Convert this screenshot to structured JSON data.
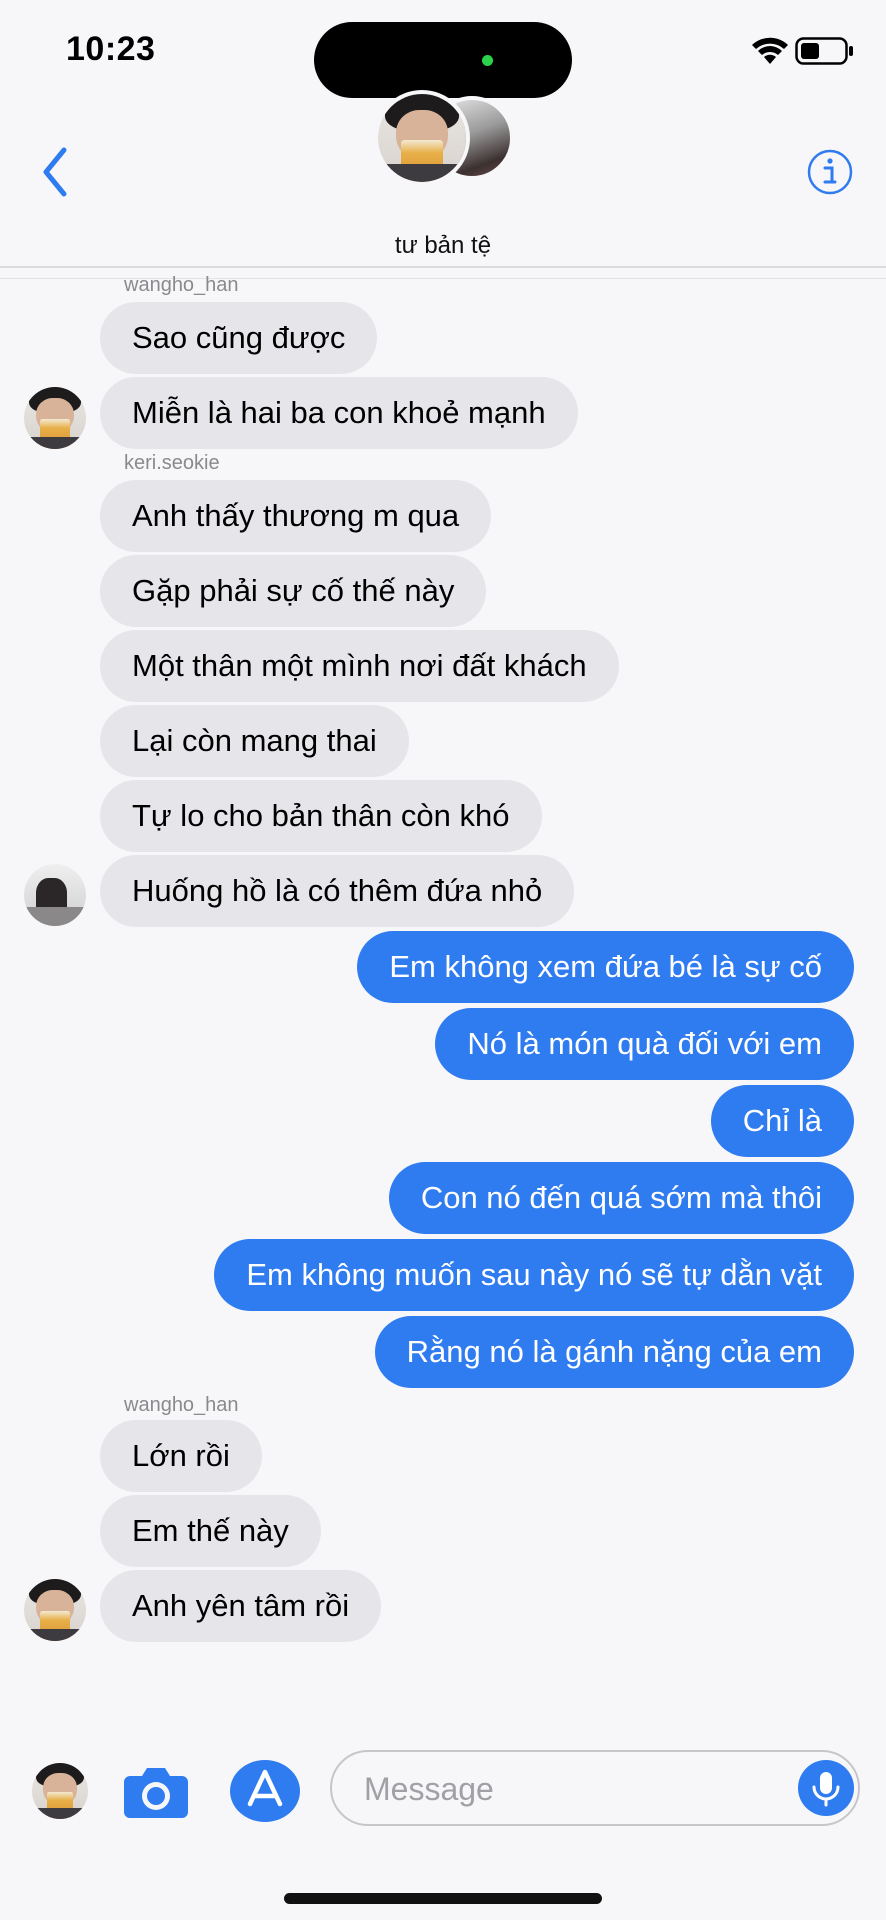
{
  "status_bar": {
    "time": "10:23"
  },
  "header": {
    "group_name": "tư bản tệ"
  },
  "colors": {
    "accent": "#2f7bf0",
    "incoming_bubble": "#e6e5ea",
    "background": "#f7f7f9"
  },
  "icons": {
    "back": "chevron-left-icon",
    "info": "info-circle-icon",
    "camera": "camera-icon",
    "apps": "app-store-icon",
    "mic": "microphone-icon"
  },
  "messages": {
    "sender_1": "wangho_han",
    "m1": "Sao cũng được",
    "m2": "Miễn là hai ba con khoẻ mạnh",
    "sender_2": "keri.seokie",
    "m3": "Anh thấy thương m qua",
    "m4": "Gặp phải sự cố thế này",
    "m5": "Một thân một mình nơi đất khách",
    "m6": "Lại còn mang thai",
    "m7": "Tự lo cho bản thân còn khó",
    "m8": "Huống hồ là có thêm đứa nhỏ",
    "o1": "Em không xem đứa bé là sự cố",
    "o2": "Nó là món quà đối với em",
    "o3": "Chỉ là",
    "o4": "Con nó đến quá sớm mà thôi",
    "o5": "Em không muốn sau này nó sẽ tự dằn vặt",
    "o6": "Rằng nó là gánh nặng của em",
    "sender_3": "wangho_han",
    "m9": "Lớn rồi",
    "m10": "Em thế này",
    "m11": "Anh yên tâm rồi"
  },
  "input": {
    "placeholder": "Message",
    "value": ""
  }
}
